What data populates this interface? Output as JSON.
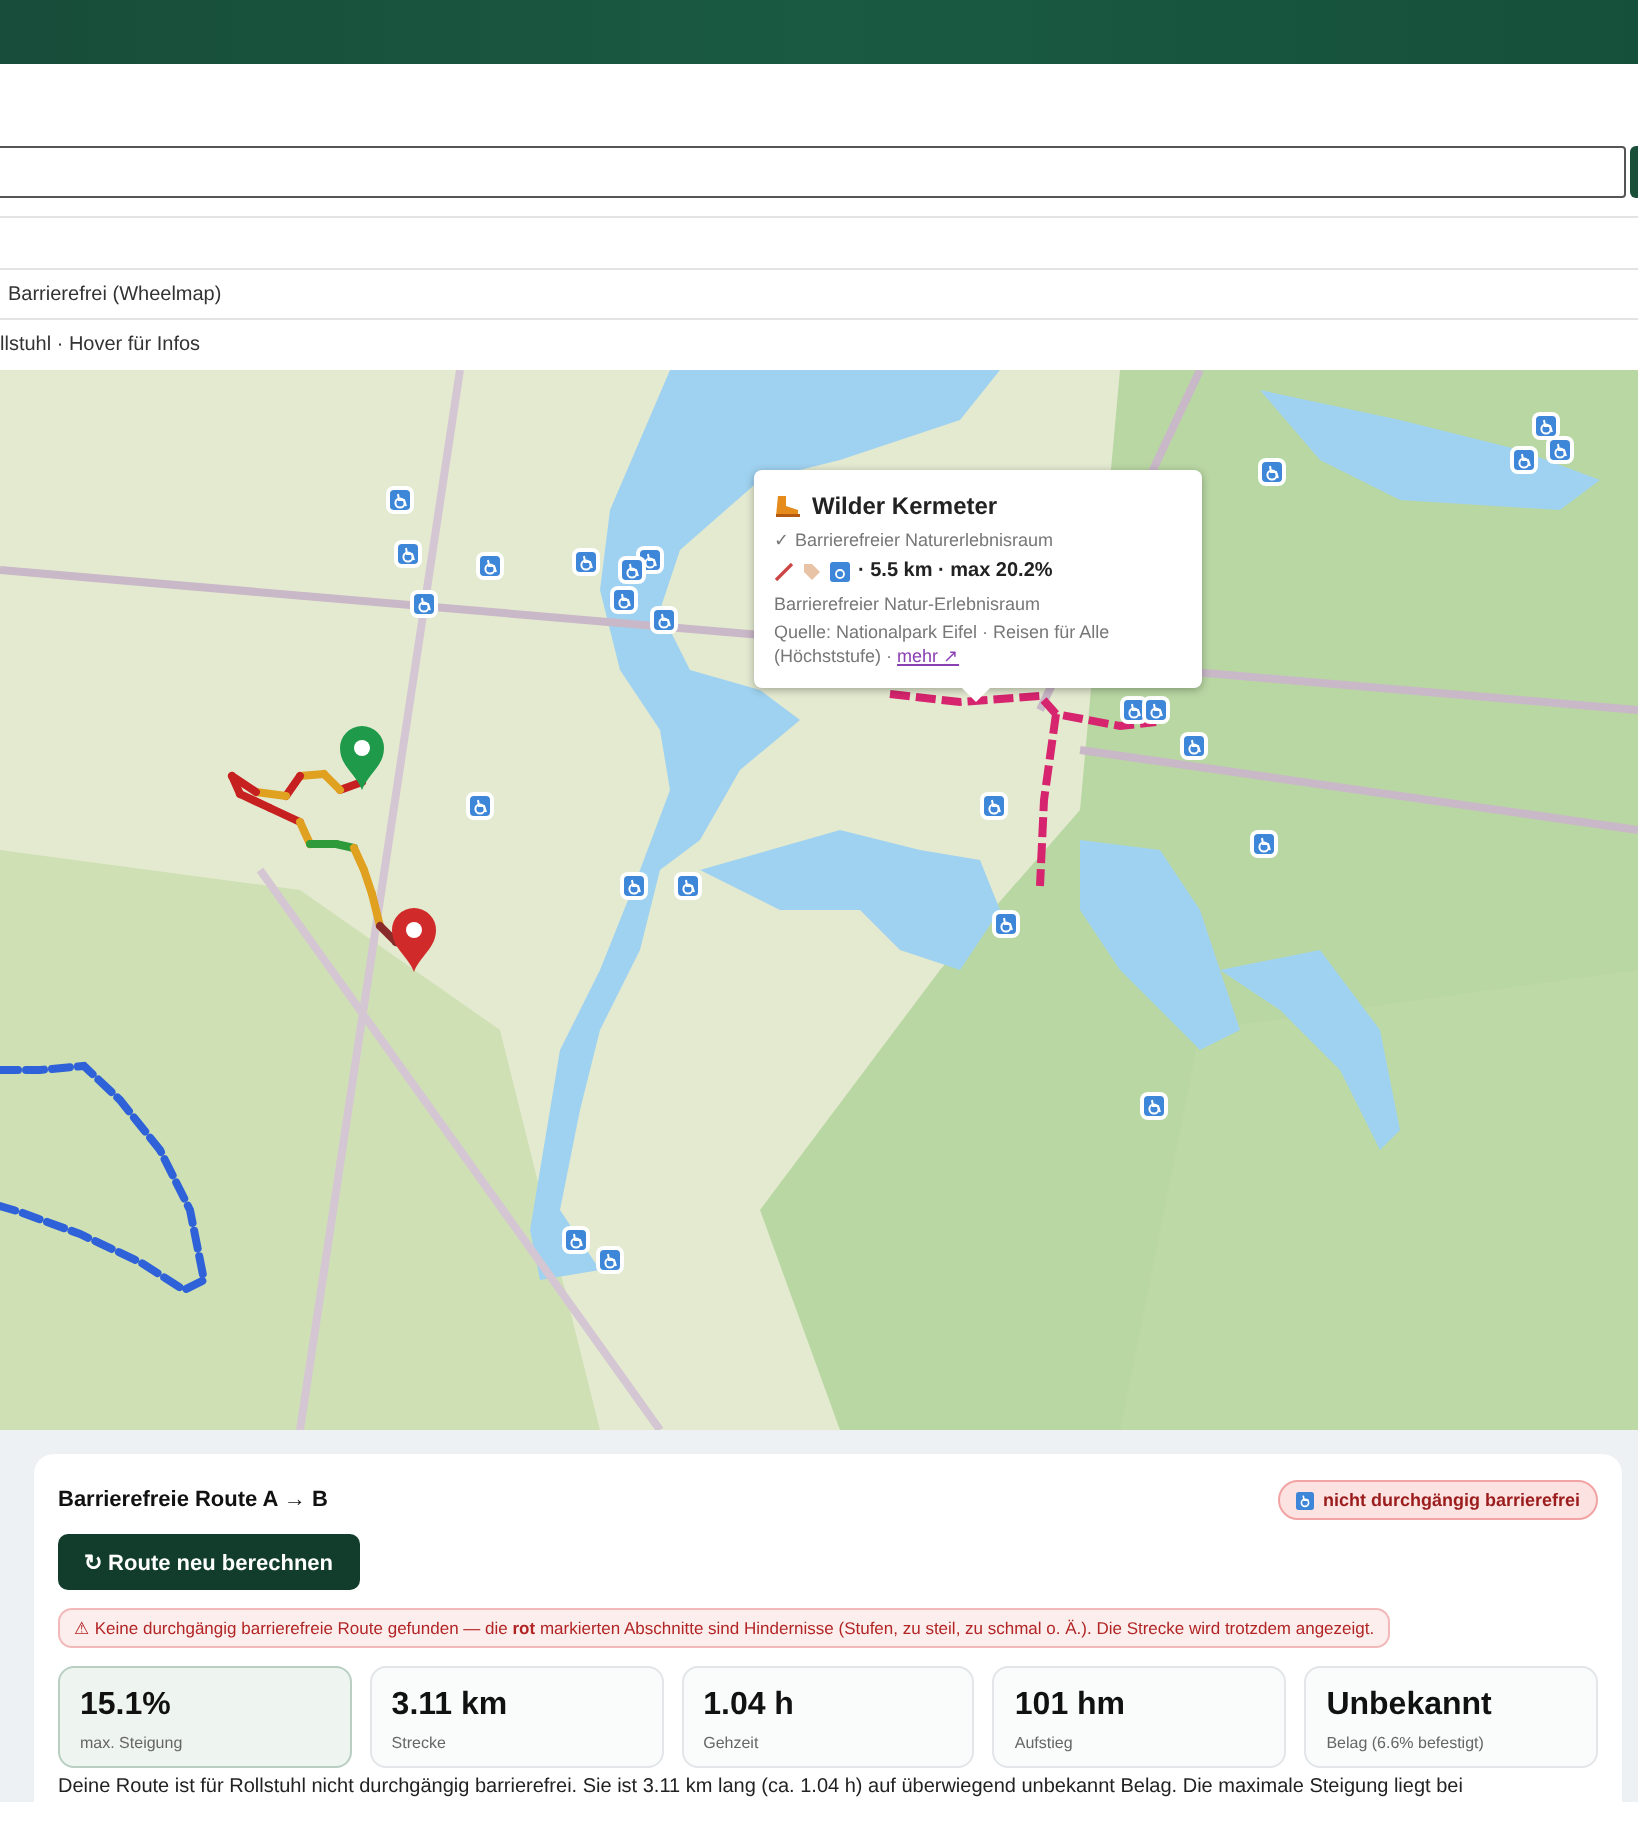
{
  "layers": [
    {
      "label": "Barrierefrei (Wheelmap)"
    }
  ],
  "hint": "llstuhl · Hover für Infos",
  "popup": {
    "title": "Wilder Kermeter",
    "subtitle": "✓ Barrierefreier Naturerlebnisraum",
    "stats": "· 5.5 km · max 20.2%",
    "description": "Barrierefreier Natur-Erlebnisraum",
    "source": "Quelle: Nationalpark Eifel · Reisen für Alle (Höchststufe) ·",
    "link": "mehr ↗"
  },
  "route": {
    "title": "Barrierefreie Route A → B",
    "accessible": false,
    "badge": "nicht durchgängig barrierefrei",
    "button": "↻ Route neu berechnen",
    "warning": "⚠ Keine durchgängig barrierefreie Route gefunden — die **rot** markierten Abschnitte sind Hindernisse (Stufen, zu steil, zu schmal o. Ä.). Die Strecke wird trotzdem angezeigt.",
    "stats": [
      {
        "value": "15.1%",
        "label": "max. Steigung",
        "selected": true
      },
      {
        "value": "3.11 km",
        "label": "Strecke",
        "selected": false
      },
      {
        "value": "1.04 h",
        "label": "Gehzeit",
        "selected": false
      },
      {
        "value": "101 hm",
        "label": "Aufstieg",
        "selected": false
      },
      {
        "value": "Unbekannt",
        "label": "Belag (6.6% befestigt)",
        "selected": false
      }
    ],
    "summary": "Deine Route ist für Rollstuhl nicht durchgängig barrierefrei. Sie ist 3.11 km lang (ca. 1.04 h) auf überwiegend unbekannt Belag. Die maximale Steigung liegt bei"
  }
}
